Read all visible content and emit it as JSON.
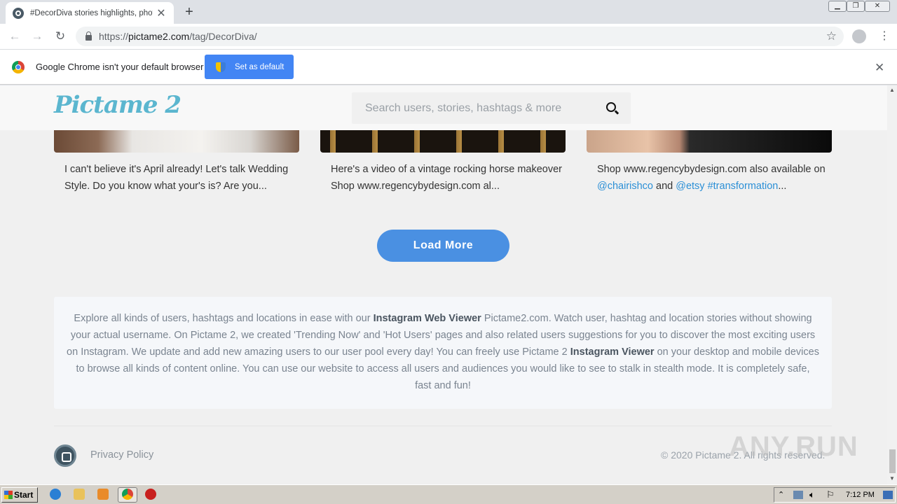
{
  "browser": {
    "tab_title": "#DecorDiva stories highlights, photos",
    "url_prefix": "https://",
    "url_domain": "pictame2.com",
    "url_path": "/tag/DecorDiva/"
  },
  "infobar": {
    "message": "Google Chrome isn't your default browser",
    "button": "Set as default"
  },
  "site": {
    "logo": "Pictame 2",
    "search_placeholder": "Search users, stories, hashtags & more"
  },
  "posts": [
    {
      "caption": "I can't believe it's April already! Let's talk Wedding Style. Do you know what your's is? Are you..."
    },
    {
      "caption": "Here's a video of a vintage rocking horse makeover Shop www.regencybydesign.com al..."
    },
    {
      "caption_start": "Shop www.regencybydesign.com also available on ",
      "link1": "@chairishco",
      "mid": " and ",
      "link2": "@etsy",
      "link3": "#transformation",
      "ellipsis": "..."
    }
  ],
  "load_more": "Load More",
  "about": {
    "p1": "Explore all kinds of users, hashtags and locations in ease with our ",
    "b1": "Instagram Web Viewer",
    "p2": " Pictame2.com. Watch user, hashtag and location stories without showing your actual username. On Pictame 2, we created 'Trending Now' and 'Hot Users' pages and also related users suggestions for you to discover the most exciting users on Instagram. We update and add new amazing users to our user pool every day! You can freely use Pictame 2 ",
    "b2": "Instagram Viewer",
    "p3": " on your desktop and mobile devices to browse all kinds of content online. You can use our website to access all users and audiences you would like to see to stalk in stealth mode. It is completely safe, fast and fun!"
  },
  "footer": {
    "privacy": "Privacy Policy",
    "copyright": "© 2020 Pictame 2. All rights reserved."
  },
  "watermark": "ANY.RUN",
  "taskbar": {
    "start": "Start",
    "clock": "7:12 PM"
  }
}
